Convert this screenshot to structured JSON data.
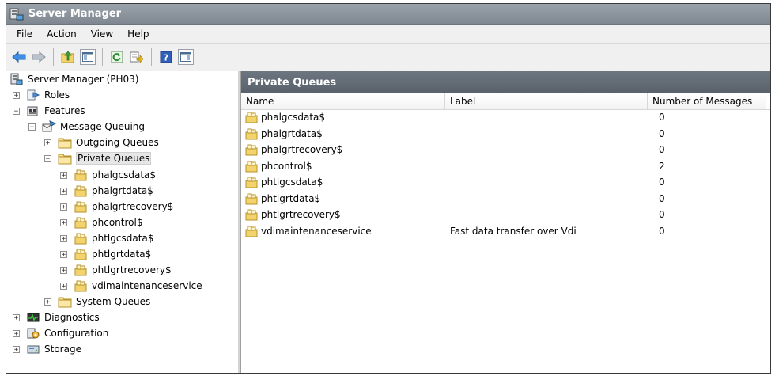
{
  "window": {
    "title": "Server Manager"
  },
  "menu": {
    "items": [
      "File",
      "Action",
      "View",
      "Help"
    ]
  },
  "toolbar": {
    "buttons": [
      "back-arrow-icon",
      "forward-arrow-icon",
      "up-folder-icon",
      "show-hide-tree-icon",
      "refresh-icon",
      "export-list-icon",
      "help-icon",
      "show-hide-action-pane-icon"
    ]
  },
  "tree": {
    "root": "Server Manager (PH03)",
    "roles": "Roles",
    "features": "Features",
    "message_queuing": "Message Queuing",
    "outgoing_queues": "Outgoing Queues",
    "private_queues": "Private Queues",
    "queues": [
      "phalgcsdata$",
      "phalgrtdata$",
      "phalgrtrecovery$",
      "phcontrol$",
      "phtlgcsdata$",
      "phtlgrtdata$",
      "phtlgrtrecovery$",
      "vdimaintenanceservice"
    ],
    "system_queues": "System Queues",
    "diagnostics": "Diagnostics",
    "configuration": "Configuration",
    "storage": "Storage"
  },
  "pane": {
    "title": "Private Queues",
    "columns": {
      "name": "Name",
      "label": "Label",
      "count": "Number of Messages"
    },
    "rows": [
      {
        "name": "phalgcsdata$",
        "label": "",
        "count": "0"
      },
      {
        "name": "phalgrtdata$",
        "label": "",
        "count": "0"
      },
      {
        "name": "phalgrtrecovery$",
        "label": "",
        "count": "0"
      },
      {
        "name": "phcontrol$",
        "label": "",
        "count": "2"
      },
      {
        "name": "phtlgcsdata$",
        "label": "",
        "count": "0"
      },
      {
        "name": "phtlgrtdata$",
        "label": "",
        "count": "0"
      },
      {
        "name": "phtlgrtrecovery$",
        "label": "",
        "count": "0"
      },
      {
        "name": "vdimaintenanceservice",
        "label": "Fast data transfer over Vdi",
        "count": "0"
      }
    ]
  }
}
